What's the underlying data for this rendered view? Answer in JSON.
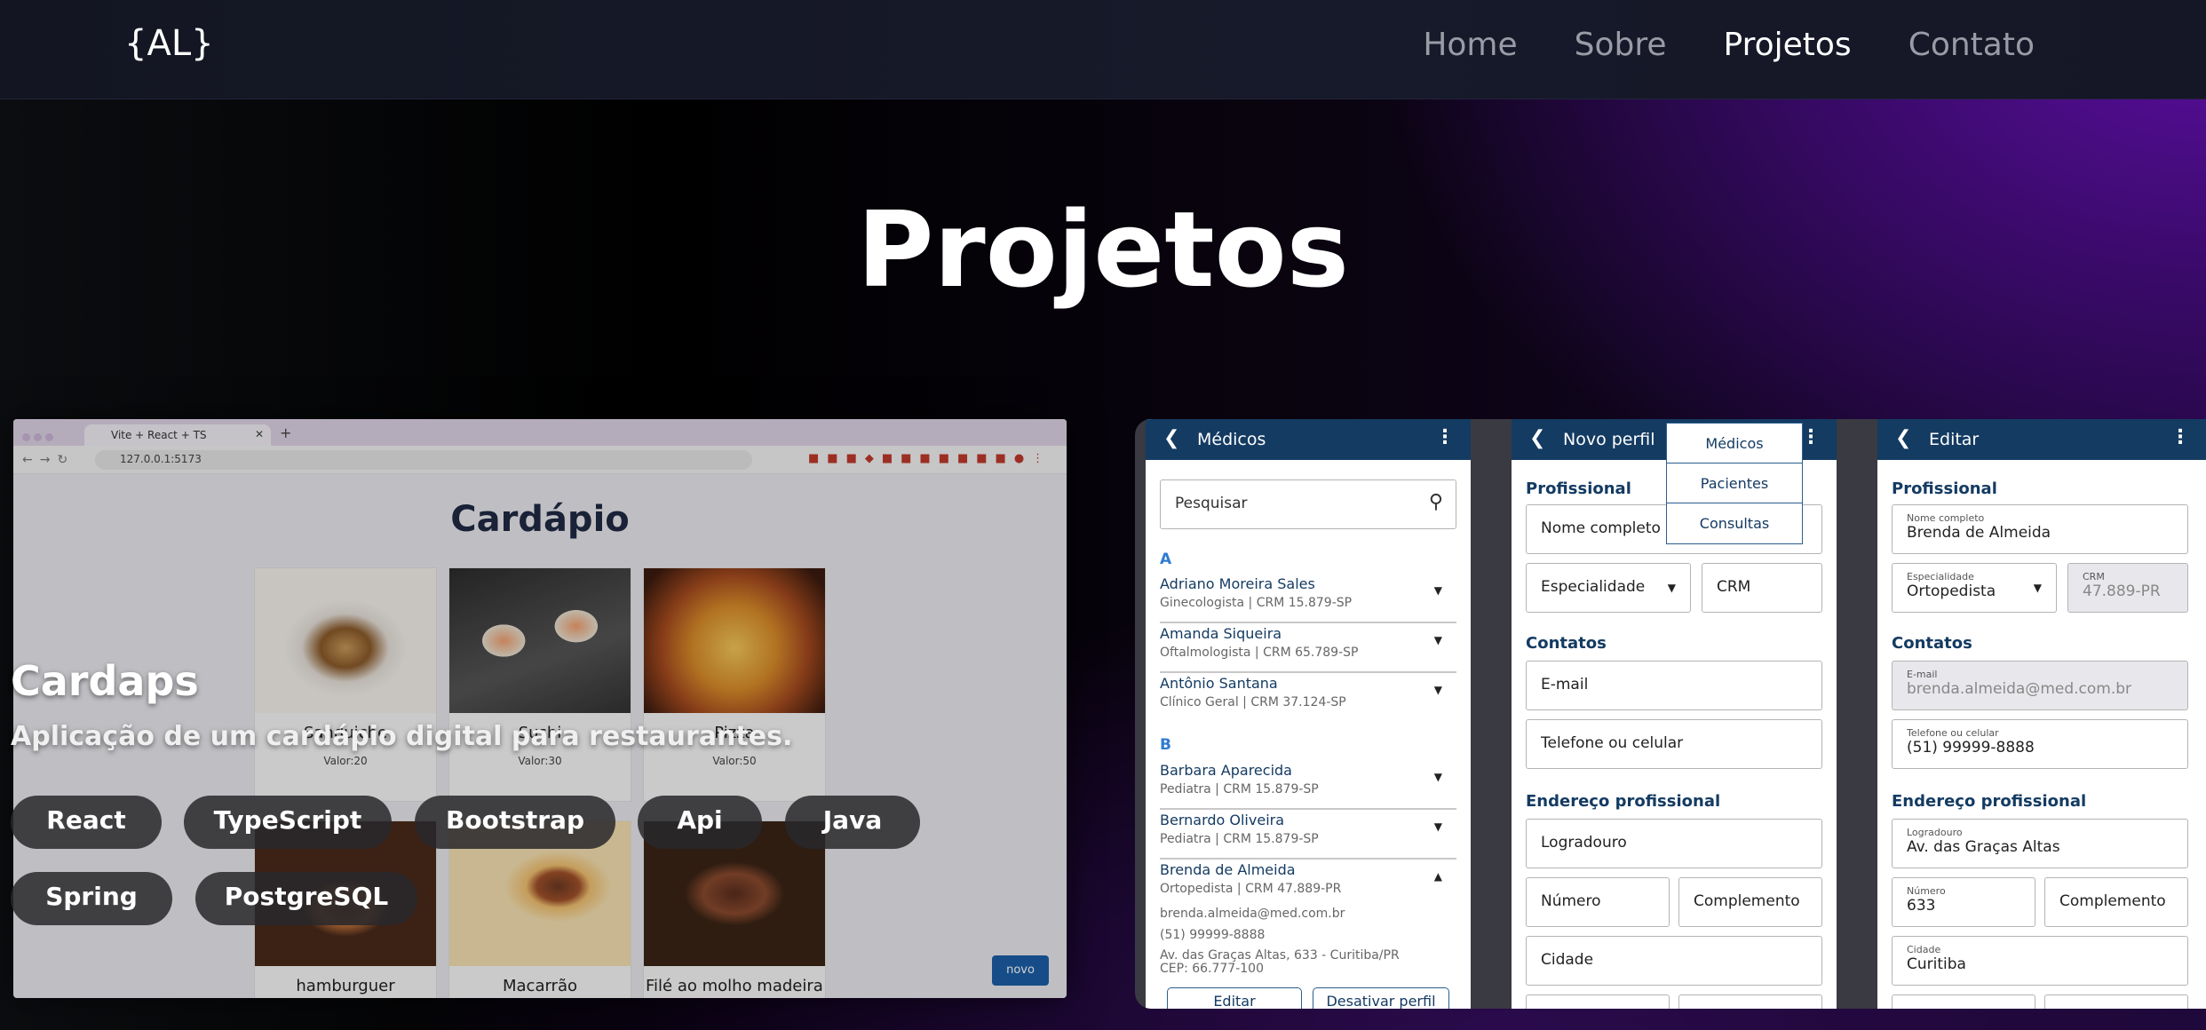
{
  "nav": {
    "logo": "{AL}",
    "links": [
      "Home",
      "Sobre",
      "Projetos",
      "Contato"
    ],
    "active": "Projetos"
  },
  "page_title": "Projetos",
  "card1": {
    "title": "Cardaps",
    "description": "Aplicação de um cardápio digital para restaurantes.",
    "tags": [
      "React",
      "TypeScript",
      "Bootstrap",
      "Api",
      "Java",
      "Spring",
      "PostgreSQL"
    ],
    "browser": {
      "tab_title": "Vite + React + TS",
      "url": "127.0.0.1:5173"
    },
    "app": {
      "heading": "Cardápio",
      "novo_button": "novo",
      "items": [
        {
          "name": "Sanduiche",
          "price": "Valor:20"
        },
        {
          "name": "Sushi",
          "price": "Valor:30"
        },
        {
          "name": "Pizza",
          "price": "Valor:50"
        },
        {
          "name": "hamburguer",
          "price": ""
        },
        {
          "name": "Macarrão",
          "price": ""
        },
        {
          "name": "Filé ao molho madeira",
          "price": ""
        }
      ]
    }
  },
  "card2": {
    "phone1": {
      "header": "Médicos",
      "search_placeholder": "Pesquisar",
      "groups": [
        {
          "letter": "A",
          "doctors": [
            {
              "name": "Adriano Moreira Sales",
              "sub": "Ginecologista | CRM 15.879-SP"
            },
            {
              "name": "Amanda Siqueira",
              "sub": "Oftalmologista | CRM 65.789-SP"
            },
            {
              "name": "Antônio Santana",
              "sub": "Clínico Geral | CRM 37.124-SP"
            }
          ]
        },
        {
          "letter": "B",
          "doctors": [
            {
              "name": "Barbara Aparecida",
              "sub": "Pediatra | CRM 15.879-SP"
            },
            {
              "name": "Bernardo Oliveira",
              "sub": "Pediatra | CRM 15.879-SP"
            },
            {
              "name": "Brenda de Almeida",
              "sub": "Ortopedista | CRM 47.889-PR"
            }
          ]
        }
      ],
      "expanded": {
        "email": "brenda.almeida@med.com.br",
        "phone": "(51) 99999-8888",
        "address": "Av. das Graças Altas, 633 - Curitiba/PR",
        "cep": "CEP: 66.777-100"
      },
      "buttons": {
        "edit": "Editar",
        "deactivate": "Desativar perfil"
      }
    },
    "phone2": {
      "header": "Novo perfil",
      "sections": {
        "prof": "Profissional",
        "contatos": "Contatos",
        "endereco": "Endereço profissional"
      },
      "fields": {
        "nome": "Nome completo",
        "especialidade": "Especialidade",
        "crm": "CRM",
        "email": "E-mail",
        "telefone": "Telefone ou celular",
        "logradouro": "Logradouro",
        "numero": "Número",
        "complemento": "Complemento",
        "cidade": "Cidade"
      },
      "menu": [
        "Médicos",
        "Pacientes",
        "Consultas"
      ]
    },
    "phone3": {
      "header": "Editar",
      "sections": {
        "prof": "Profissional",
        "contatos": "Contatos",
        "endereco": "Endereço profissional"
      },
      "fields": [
        {
          "label": "Nome completo",
          "value": "Brenda de Almeida"
        },
        {
          "label": "Especialidade",
          "value": "Ortopedista"
        },
        {
          "label": "CRM",
          "value": "47.889-PR"
        },
        {
          "label": "E-mail",
          "value": "brenda.almeida@med.com.br"
        },
        {
          "label": "Telefone ou celular",
          "value": "(51) 99999-8888"
        },
        {
          "label": "Logradouro",
          "value": "Av. das Graças Altas"
        },
        {
          "label": "Número",
          "value": "633"
        },
        {
          "label": "Complemento",
          "value": ""
        },
        {
          "label": "Cidade",
          "value": "Curitiba"
        }
      ]
    }
  },
  "colors": {
    "accent": "#143b62",
    "purple": "#5a0e9e",
    "tag_bg": "#28282c"
  }
}
